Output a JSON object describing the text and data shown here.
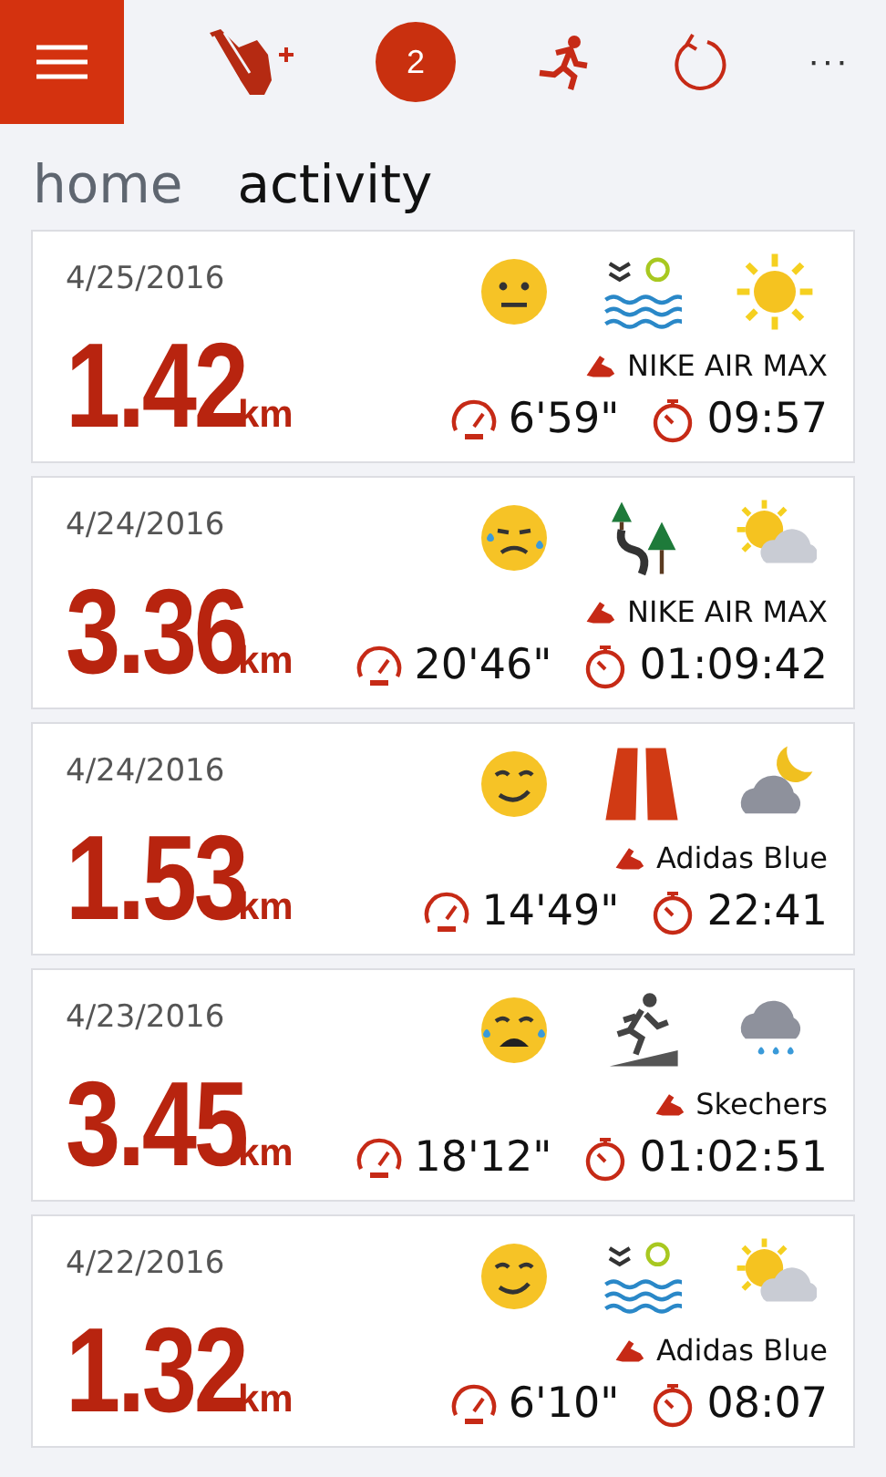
{
  "app_bar": {
    "badge": "2",
    "more": "···"
  },
  "pivot": [
    {
      "label": "home",
      "selected": false
    },
    {
      "label": "activity",
      "selected": true
    }
  ],
  "activities": [
    {
      "date": "4/25/2016",
      "distance": "1.42",
      "unit": "km",
      "icons": [
        {
          "kind": "neutral"
        },
        {
          "kind": "water"
        },
        {
          "kind": "sunny"
        }
      ],
      "shoe": "NIKE AIR MAX",
      "pace": "6'59\"",
      "duration": "09:57"
    },
    {
      "date": "4/24/2016",
      "distance": "3.36",
      "unit": "km",
      "icons": [
        {
          "kind": "sweat"
        },
        {
          "kind": "trail"
        },
        {
          "kind": "partly_cloudy"
        }
      ],
      "shoe": "NIKE AIR MAX",
      "pace": "20'46\"",
      "duration": "01:09:42"
    },
    {
      "date": "4/24/2016",
      "distance": "1.53",
      "unit": "km",
      "icons": [
        {
          "kind": "smile"
        },
        {
          "kind": "road"
        },
        {
          "kind": "night"
        }
      ],
      "shoe": "Adidas Blue",
      "pace": "14'49\"",
      "duration": "22:41"
    },
    {
      "date": "4/23/2016",
      "distance": "3.45",
      "unit": "km",
      "icons": [
        {
          "kind": "crying"
        },
        {
          "kind": "treadmill"
        },
        {
          "kind": "rain"
        }
      ],
      "shoe": "Skechers",
      "pace": "18'12\"",
      "duration": "01:02:51"
    },
    {
      "date": "4/22/2016",
      "distance": "1.32",
      "unit": "km",
      "icons": [
        {
          "kind": "smile"
        },
        {
          "kind": "water"
        },
        {
          "kind": "partly_cloudy"
        }
      ],
      "shoe": "Adidas Blue",
      "pace": "6'10\"",
      "duration": "08:07"
    }
  ]
}
